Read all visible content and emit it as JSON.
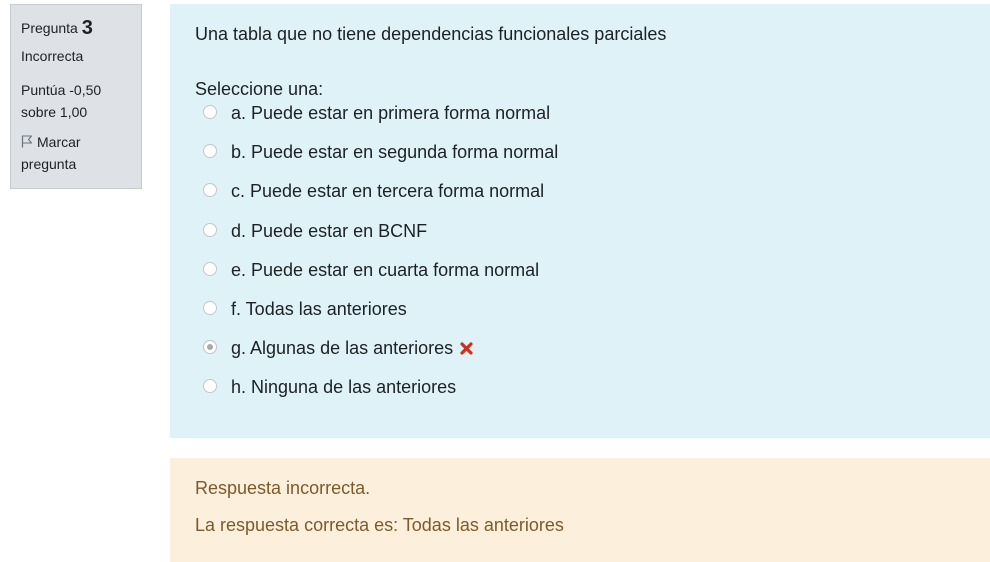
{
  "info": {
    "question_label": "Pregunta",
    "question_number": "3",
    "state": "Incorrecta",
    "grade_line1": "Puntúa -0,50",
    "grade_line2": "sobre 1,00",
    "flag_line1": "Marcar",
    "flag_line2": "pregunta",
    "flag_icon": "flag-icon"
  },
  "question": {
    "text": "Una tabla que no tiene dependencias funcionales parciales",
    "prompt": "Seleccione una:",
    "options": [
      {
        "label": "a. Puede estar en primera forma normal",
        "selected": false
      },
      {
        "label": "b. Puede estar en segunda forma normal",
        "selected": false
      },
      {
        "label": "c. Puede estar en tercera forma normal",
        "selected": false
      },
      {
        "label": "d. Puede estar en BCNF",
        "selected": false
      },
      {
        "label": "e. Puede estar en cuarta forma normal",
        "selected": false
      },
      {
        "label": "f. Todas las anteriores",
        "selected": false
      },
      {
        "label": "g. Algunas de las anteriores",
        "selected": true,
        "mark": "incorrect-icon"
      },
      {
        "label": "h. Ninguna de las anteriores",
        "selected": false
      }
    ]
  },
  "feedback": {
    "result": "Respuesta incorrecta.",
    "correct_answer": "La respuesta correcta es: Todas las anteriores"
  },
  "colors": {
    "formulation_bg": "#def2f8",
    "feedback_bg": "#fcefdc",
    "feedback_text": "#7d5a29",
    "info_bg": "#dee2e6",
    "incorrect_mark": "#ca3120"
  }
}
